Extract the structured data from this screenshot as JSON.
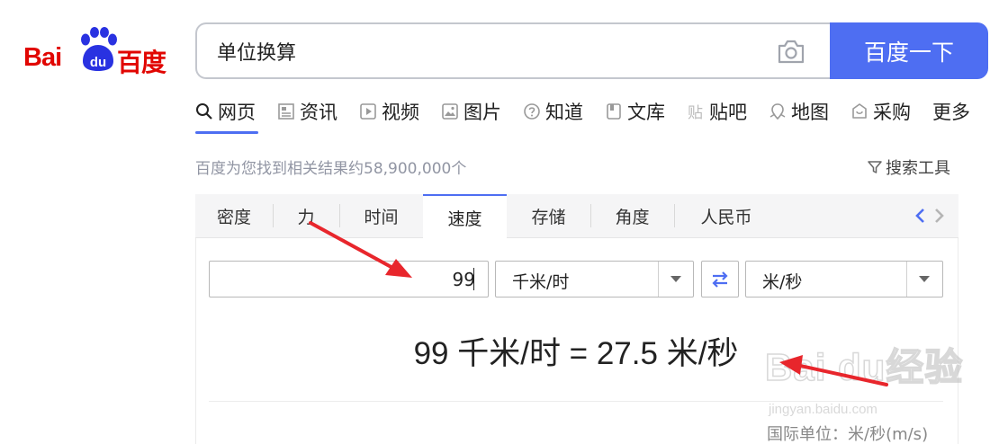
{
  "logo": {
    "left_text": "Bai",
    "paw_text": "du",
    "right_text": "百度"
  },
  "search": {
    "query": "单位换算",
    "button_label": "百度一下"
  },
  "nav": {
    "items": [
      {
        "label": "网页",
        "icon": "search-icon"
      },
      {
        "label": "资讯",
        "icon": "news-icon"
      },
      {
        "label": "视频",
        "icon": "video-icon"
      },
      {
        "label": "图片",
        "icon": "image-icon"
      },
      {
        "label": "知道",
        "icon": "question-icon"
      },
      {
        "label": "文库",
        "icon": "doc-icon"
      },
      {
        "label": "贴吧",
        "icon": "tieba-icon"
      },
      {
        "label": "地图",
        "icon": "map-icon"
      },
      {
        "label": "采购",
        "icon": "shop-icon"
      },
      {
        "label": "更多",
        "icon": ""
      }
    ],
    "active": "网页"
  },
  "results": {
    "count_text": "百度为您找到相关结果约58,900,000个",
    "tools_label": "搜索工具"
  },
  "converter": {
    "tabs": [
      "密度",
      "力",
      "时间",
      "速度",
      "存储",
      "角度",
      "人民币"
    ],
    "active_tab": "速度",
    "input_value": "99",
    "from_unit": "千米/时",
    "to_unit": "米/秒",
    "result_text": "99 千米/时 = 27.5 米/秒",
    "si_unit_text": "国际单位：米/秒(m/s)"
  },
  "colors": {
    "brand_red": "#e10602",
    "brand_blue": "#4e6ef2",
    "annotation_red": "#e8262c"
  },
  "watermark": {
    "text": "Bai du经验",
    "url": "jingyan.baidu.com"
  }
}
